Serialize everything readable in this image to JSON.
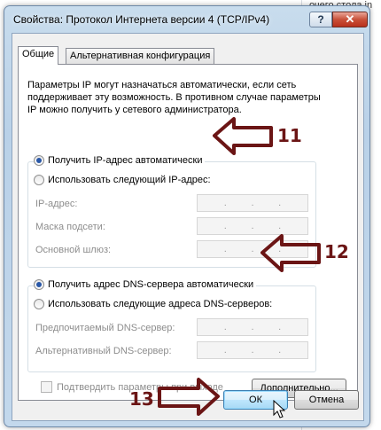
{
  "background": {
    "text": "очего стола in"
  },
  "dialog": {
    "title": "Свойства: Протокол Интернета версии 4 (TCP/IPv4)",
    "help_label": "?",
    "close_label": "✕"
  },
  "tabs": [
    {
      "label": "Общие",
      "active": true
    },
    {
      "label": "Альтернативная конфигурация",
      "active": false
    }
  ],
  "description": "Параметры IP могут назначаться автоматически, если сеть поддерживает эту возможность. В противном случае параметры IP можно получить у сетевого администратора.",
  "ip_group": {
    "auto_label": "Получить IP-адрес автоматически",
    "auto_checked": true,
    "manual_label": "Использовать следующий IP-адрес:",
    "manual_checked": false,
    "fields": [
      {
        "label": "IP-адрес:",
        "value": ". . ."
      },
      {
        "label": "Маска подсети:",
        "value": ". . ."
      },
      {
        "label": "Основной шлюз:",
        "value": ". . ."
      }
    ]
  },
  "dns_group": {
    "auto_label": "Получить адрес DNS-сервера автоматически",
    "auto_checked": true,
    "manual_label": "Использовать следующие адреса DNS-серверов:",
    "manual_checked": false,
    "fields": [
      {
        "label": "Предпочитаемый DNS-сервер:",
        "value": ". . ."
      },
      {
        "label": "Альтернативный DNS-сервер:",
        "value": ". . ."
      }
    ]
  },
  "validate_on_exit_label": "Подтвердить параметры при выходе",
  "advanced_button": "Дополнительно...",
  "ok_button": "ОК",
  "cancel_button": "Отмена",
  "annotations": {
    "step_ip": "11",
    "step_dns": "12",
    "step_ok": "13",
    "color": "#6b1515"
  }
}
